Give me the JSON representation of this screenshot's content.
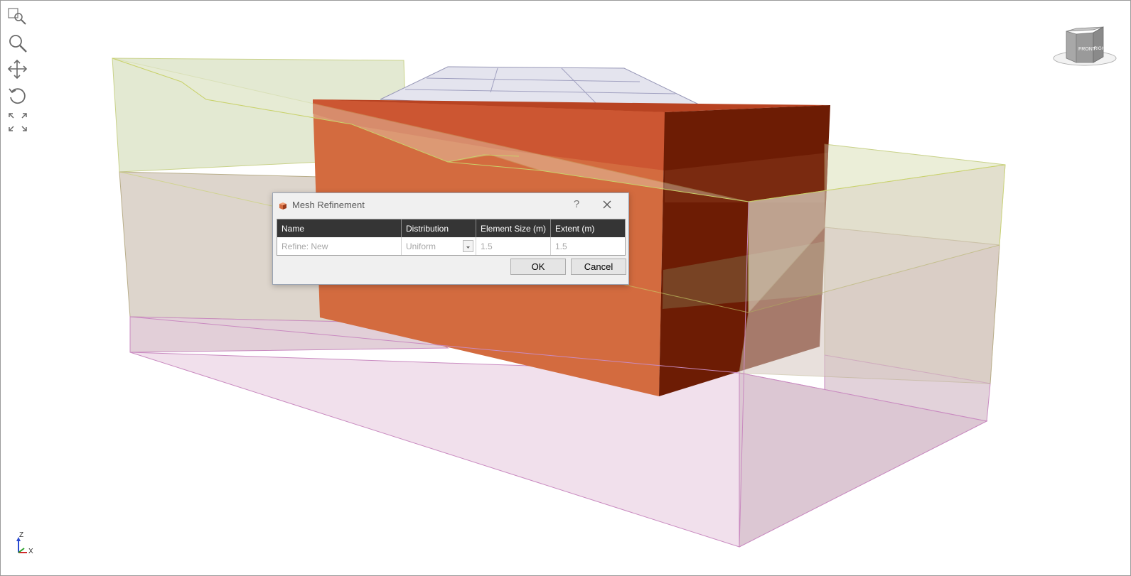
{
  "dialog": {
    "title": "Mesh Refinement",
    "help_label": "?",
    "columns": [
      "Name",
      "Distribution",
      "Element Size (m)",
      "Extent (m)"
    ],
    "row": {
      "name": "Refine: New",
      "distribution": "Uniform",
      "element_size": "1.5",
      "extent": "1.5"
    },
    "ok_label": "OK",
    "cancel_label": "Cancel"
  },
  "viewcube": {
    "front_label": "FRONT",
    "right_label": "RIGHT"
  },
  "axis_triad": {
    "z_label": "Z",
    "x_label": "X"
  },
  "toolbar": {
    "tools": [
      "zoom-window-icon",
      "zoom-icon",
      "pan-icon",
      "rotate-icon",
      "zoom-extents-icon"
    ]
  },
  "colors": {
    "refinement_box_front": "#d2693e",
    "refinement_box_top": "#c9532f",
    "refinement_box_side": "#6a1a04",
    "soil_top_layer": "#e6ebd5",
    "soil_mid_layer": "#dcd3cb",
    "soil_bottom_layer": "#efe0ec",
    "embankment": "#e4e4ef"
  }
}
